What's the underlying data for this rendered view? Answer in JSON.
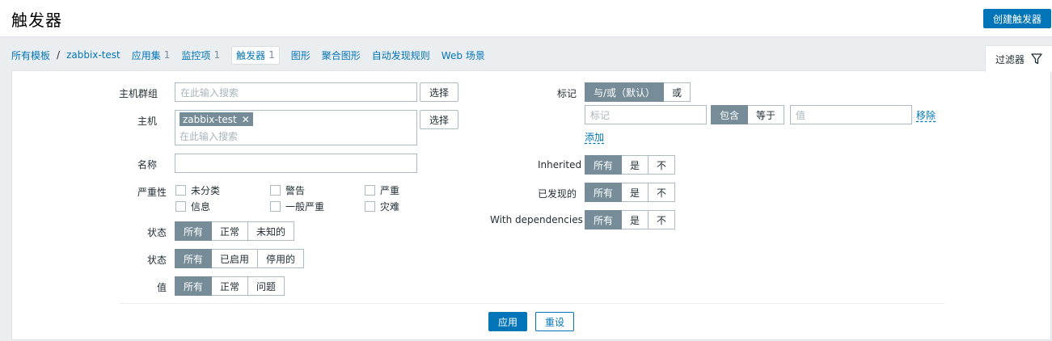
{
  "header": {
    "title": "触发器",
    "create_button": "创建触发器"
  },
  "nav": {
    "all_templates": "所有模板",
    "separator": "/",
    "template": "zabbix-test",
    "items": [
      {
        "label": "应用集",
        "count": "1"
      },
      {
        "label": "监控项",
        "count": "1"
      },
      {
        "label": "触发器",
        "count": "1",
        "active": true
      },
      {
        "label": "图形",
        "count": ""
      },
      {
        "label": "聚合图形",
        "count": ""
      },
      {
        "label": "自动发现规则",
        "count": ""
      },
      {
        "label": "Web 场景",
        "count": ""
      }
    ]
  },
  "filter_tab": {
    "label": "过滤器",
    "icon": "funnel-icon"
  },
  "filter": {
    "host_group": {
      "label": "主机群组",
      "placeholder": "在此输入搜索",
      "select": "选择"
    },
    "host": {
      "label": "主机",
      "tag": "zabbix-test",
      "placeholder": "在此输入搜索",
      "select": "选择"
    },
    "name": {
      "label": "名称",
      "value": ""
    },
    "severity": {
      "label": "严重性",
      "options": [
        "未分类",
        "警告",
        "严重",
        "信息",
        "一般严重",
        "灾难"
      ]
    },
    "state": {
      "label": "状态",
      "options": [
        "所有",
        "正常",
        "未知的"
      ],
      "selected": "所有"
    },
    "status": {
      "label": "状态",
      "options": [
        "所有",
        "已启用",
        "停用的"
      ],
      "selected": "所有"
    },
    "value": {
      "label": "值",
      "options": [
        "所有",
        "正常",
        "问题"
      ],
      "selected": "所有"
    },
    "tags": {
      "label": "标记",
      "eval_options": [
        "与/或（默认）",
        "或"
      ],
      "eval_selected": "与/或（默认）",
      "tag_placeholder": "标记",
      "operator_options": [
        "包含",
        "等于"
      ],
      "operator_selected": "包含",
      "value_placeholder": "值",
      "remove": "移除",
      "add": "添加"
    },
    "inherited": {
      "label": "Inherited",
      "options": [
        "所有",
        "是",
        "不"
      ],
      "selected": "所有"
    },
    "discovered": {
      "label": "已发现的",
      "options": [
        "所有",
        "是",
        "不"
      ],
      "selected": "所有"
    },
    "dependencies": {
      "label": "With dependencies",
      "options": [
        "所有",
        "是",
        "不"
      ],
      "selected": "所有"
    },
    "apply": "应用",
    "reset": "重设"
  },
  "colors": {
    "accent": "#0275b8",
    "segment_selected": "#768d99",
    "background": "#ebeef0"
  }
}
